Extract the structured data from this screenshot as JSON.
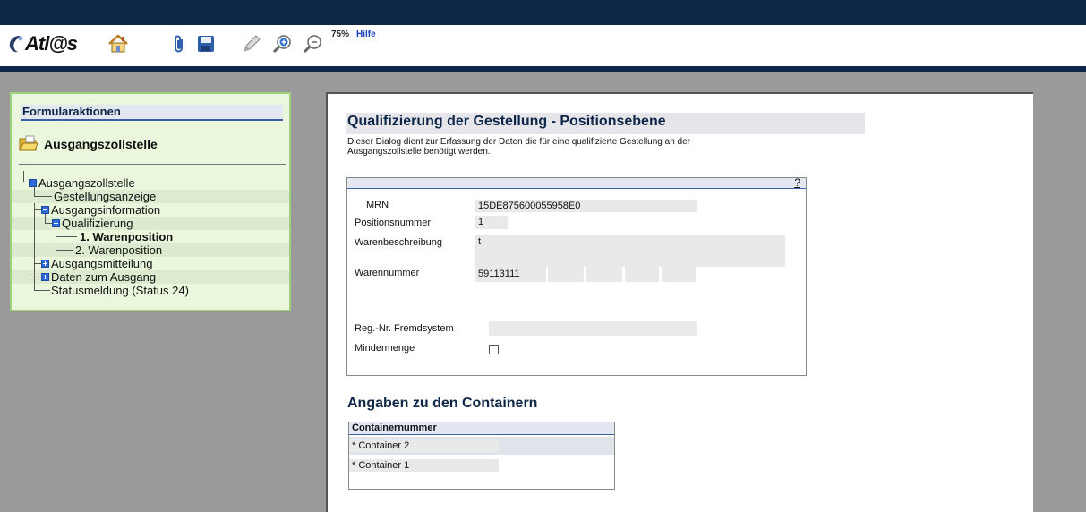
{
  "app": {
    "logo_text": "Atl@s"
  },
  "toolbar": {
    "zoom": "75%",
    "help_label": "Hilfe",
    "icons": [
      "home-icon",
      "paperclip-icon",
      "save-icon",
      "pencil-icon",
      "zoom-in-icon",
      "zoom-out-icon"
    ]
  },
  "sidebar": {
    "header": "Formularaktionen",
    "title": "Ausgangszollstelle",
    "tree": [
      {
        "label": "Ausgangszollstelle"
      },
      {
        "label": "Gestellungsanzeige"
      },
      {
        "label": "Ausgangsinformation"
      },
      {
        "label": "Qualifizierung"
      },
      {
        "label": "1. Warenposition"
      },
      {
        "label": "2. Warenposition"
      },
      {
        "label": "Ausgangsmitteilung"
      },
      {
        "label": "Daten zum Ausgang"
      },
      {
        "label": "Statusmeldung (Status 24)"
      }
    ]
  },
  "form": {
    "title": "Qualifizierung der Gestellung - Positionsebene",
    "description": "Dieser Dialog dient zur Erfassung der Daten die für eine qualifizierte Gestellung an der Ausgangszollstelle benötigt werden.",
    "help_mark": "?",
    "fields": {
      "mrn_label": "MRN",
      "mrn_value": "15DE875600055958E0",
      "pos_label": "Positionsnummer",
      "pos_value": "1",
      "desc_label": "Warenbeschreibung",
      "desc_value": "t",
      "wn_label": "Warennummer",
      "wn_value": "59113111",
      "reg_label": "Reg.-Nr. Fremdsystem",
      "reg_value": "",
      "minder_label": "Mindermenge"
    }
  },
  "containers": {
    "section_title": "Angaben zu den Containern",
    "column_header": "Containernummer",
    "rows": [
      {
        "text": "* Container 2"
      },
      {
        "text": "* Container 1"
      }
    ]
  }
}
